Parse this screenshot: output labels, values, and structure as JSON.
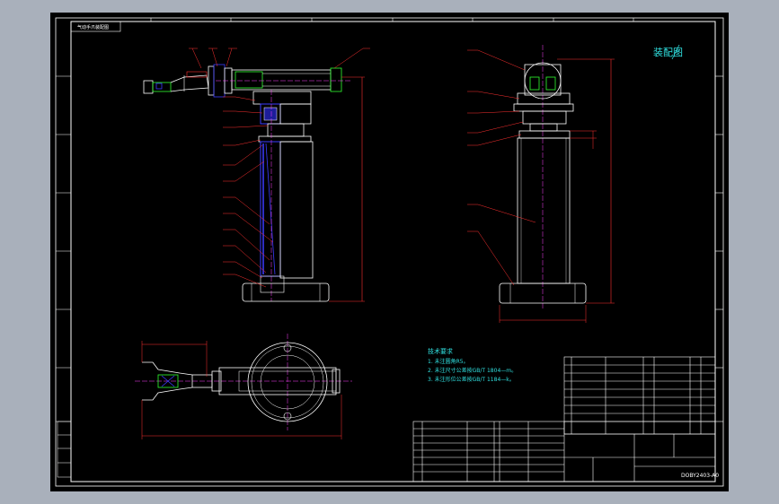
{
  "drawing": {
    "title_tag": "气动手爪装配图",
    "stamp": "装配图",
    "drawing_no": "DOBY2403-A0"
  },
  "tech_req": {
    "heading": "技术要求",
    "items": [
      "1. 未注圆角R5。",
      "2. 未注尺寸公差按GB/T 1804—m。",
      "3. 未注形位公差按GB/T 1184—k。"
    ]
  },
  "colors": {
    "canvas": "#a9b0bb",
    "paper": "#000000",
    "line": "#ffffff",
    "dimension": "#ff2020",
    "center": "#ff40ff",
    "part_green": "#30ff30",
    "part_blue": "#3c3cff",
    "note": "#30e0e0",
    "stamp": "#30e0e0"
  }
}
